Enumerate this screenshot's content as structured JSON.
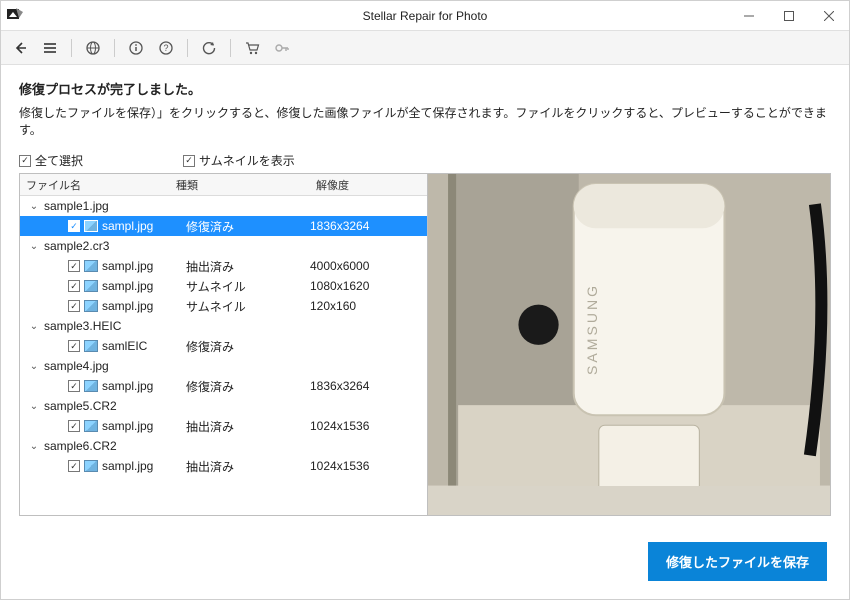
{
  "window": {
    "title": "Stellar Repair for Photo"
  },
  "toolbar": {
    "back": "back",
    "menu": "menu",
    "globe": "language",
    "info": "info",
    "help": "help",
    "refresh": "refresh",
    "cart": "buy",
    "key": "activate"
  },
  "messages": {
    "heading": "修復プロセスが完了しました。",
    "sub": "修復したファイルを保存）」をクリックすると、修復した画像ファイルが全て保存されます。ファイルをクリックすると、プレビューすることができます。"
  },
  "controls": {
    "select_all": "全て選択",
    "show_thumbnails": "サムネイルを表示",
    "save_button": "修復したファイルを保存"
  },
  "columns": {
    "name": "ファイル名",
    "type": "種類",
    "resolution": "解像度"
  },
  "groups": [
    {
      "label": "sample1.jpg",
      "files": [
        {
          "name": "sampl.jpg",
          "type": "修復済み",
          "resolution": "1836x3264",
          "checked": true,
          "selected": true
        }
      ]
    },
    {
      "label": "sample2.cr3",
      "files": [
        {
          "name": "sampl.jpg",
          "type": "抽出済み",
          "resolution": "4000x6000",
          "checked": true
        },
        {
          "name": "sampl.jpg",
          "type": "サムネイル",
          "resolution": "1080x1620",
          "checked": true
        },
        {
          "name": "sampl.jpg",
          "type": "サムネイル",
          "resolution": "120x160",
          "checked": true
        }
      ]
    },
    {
      "label": "sample3.HEIC",
      "files": [
        {
          "name": "samlEIC",
          "type": "修復済み",
          "resolution": "",
          "checked": true
        }
      ]
    },
    {
      "label": "sample4.jpg",
      "files": [
        {
          "name": "sampl.jpg",
          "type": "修復済み",
          "resolution": "1836x3264",
          "checked": true
        }
      ]
    },
    {
      "label": "sample5.CR2",
      "files": [
        {
          "name": "sampl.jpg",
          "type": "抽出済み",
          "resolution": "1024x1536",
          "checked": true
        }
      ]
    },
    {
      "label": "sample6.CR2",
      "files": [
        {
          "name": "sampl.jpg",
          "type": "抽出済み",
          "resolution": "1024x1536",
          "checked": true
        }
      ]
    }
  ]
}
